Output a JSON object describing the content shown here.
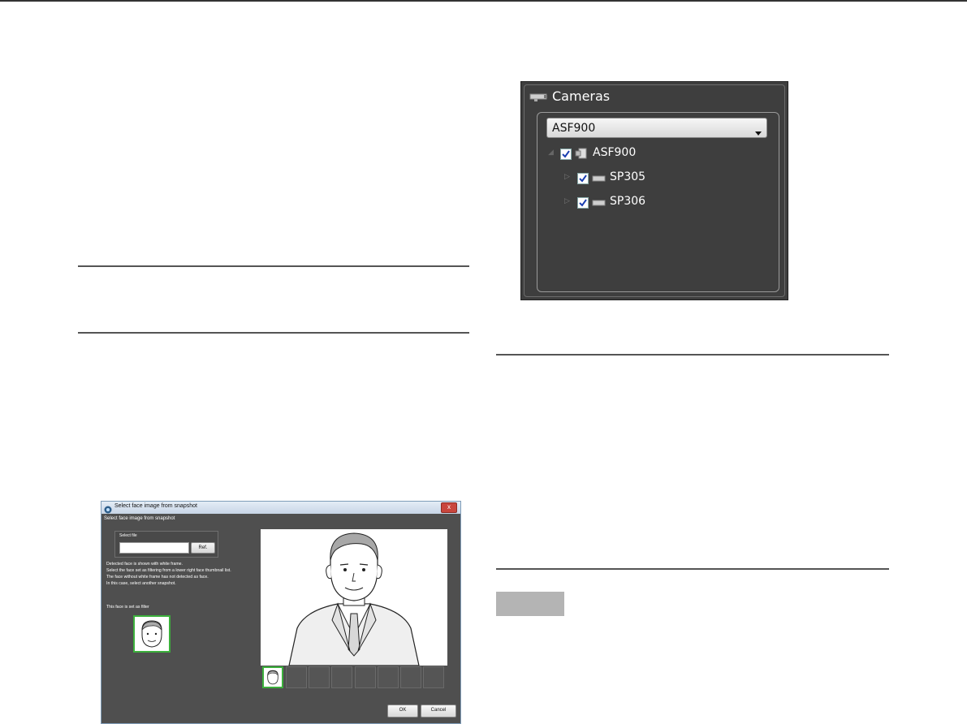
{
  "cameras_panel": {
    "title": "Cameras",
    "dropdown_value": "ASF900",
    "tree": [
      {
        "label": "ASF900",
        "checked": true,
        "icon": "recorder-icon"
      },
      {
        "label": "SP305",
        "checked": true,
        "icon": "camera-icon"
      },
      {
        "label": "SP306",
        "checked": true,
        "icon": "camera-icon"
      }
    ]
  },
  "dialog": {
    "window_title": "Select face image from snapshot",
    "close_label": "x",
    "header": "Select face image from snapshot",
    "select_file_label": "Select file",
    "ref_button": "Ref.",
    "instructions": [
      "Detected face is shown with white frame.",
      "Select the face set as filtering from a lower right face thumbnail list.",
      "The face without white frame has not detected as face.",
      "In this case, select another snapshot."
    ],
    "filter_label": "This face is set as filter",
    "ok_button": "OK",
    "cancel_button": "Cancel"
  },
  "colors": {
    "panel_bg": "#3e3e3e",
    "dialog_bg": "#4f4f4f",
    "face_frame": "#3cb03c",
    "rule": "#555555",
    "note_block": "#b4b4b4"
  }
}
